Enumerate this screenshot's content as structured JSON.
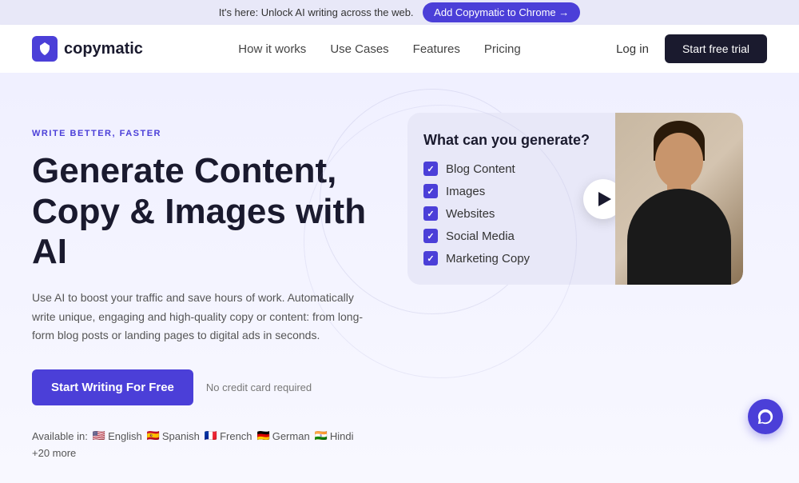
{
  "banner": {
    "text": "It's here: Unlock AI writing across the web.",
    "cta_label": "Add Copymatic to Chrome →",
    "cta_href": "#"
  },
  "navbar": {
    "logo_text": "copymatic",
    "links": [
      {
        "label": "How it works",
        "href": "#"
      },
      {
        "label": "Use Cases",
        "href": "#"
      },
      {
        "label": "Features",
        "href": "#"
      },
      {
        "label": "Pricing",
        "href": "#"
      }
    ],
    "login_label": "Log in",
    "trial_label": "Start free trial"
  },
  "hero": {
    "tag": "WRITE BETTER, FASTER",
    "headline": "Generate Content,\nCopy & Images with AI",
    "subtext": "Use AI to boost your traffic and save hours of work. Automatically write unique, engaging and high-quality copy or content: from long-form blog posts or landing pages to digital ads in seconds.",
    "cta_label": "Start Writing For Free",
    "no_cc": "No credit card required"
  },
  "languages": {
    "prefix": "Available in:",
    "items": [
      {
        "flag": "🇺🇸",
        "label": "English"
      },
      {
        "flag": "🇪🇸",
        "label": "Spanish"
      },
      {
        "flag": "🇫🇷",
        "label": "French"
      },
      {
        "flag": "🇩🇪",
        "label": "German"
      },
      {
        "flag": "🇮🇳",
        "label": "Hindi"
      }
    ],
    "more": "+20 more"
  },
  "video_card": {
    "title": "What can you generate?",
    "items": [
      "Blog Content",
      "Images",
      "Websites",
      "Social Media",
      "Marketing Copy"
    ]
  },
  "chat": {
    "icon": "💬"
  }
}
